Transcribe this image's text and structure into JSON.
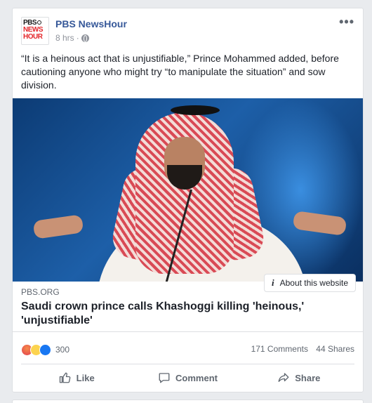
{
  "post": {
    "page_name": "PBS NewsHour",
    "time": "8 hrs",
    "separator": "·",
    "privacy_icon": "globe-icon",
    "more_label": "•••",
    "text": "“It is a heinous act that is unjustifiable,” Prince Mohammed added, before cautioning anyone who might try “to manipulate the situation” and sow division.",
    "avatar": {
      "line1": "PBS",
      "line2": "NEWS",
      "line3": "HOUR"
    }
  },
  "link": {
    "about_label": "About this website",
    "domain": "PBS.ORG",
    "title": "Saudi crown prince calls Khashoggi killing 'heinous,' 'unjustifiable'"
  },
  "stats": {
    "reaction_count": "300",
    "reactions": [
      "angry-icon",
      "haha-icon",
      "like-icon"
    ],
    "comments": "171 Comments",
    "shares": "44 Shares"
  },
  "actions": {
    "like": "Like",
    "comment": "Comment",
    "share": "Share"
  },
  "colors": {
    "link_blue": "#365899",
    "secondary_text": "#606770",
    "like_blue": "#1877f2"
  }
}
